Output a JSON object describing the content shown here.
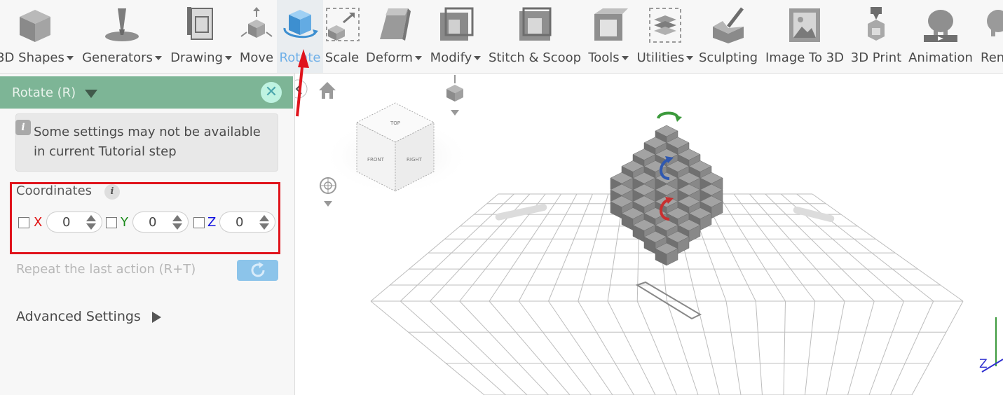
{
  "toolbar": {
    "items": [
      {
        "label": "3D Shapes",
        "dropdown": true,
        "icon": "cube-icon"
      },
      {
        "label": "Generators",
        "dropdown": true,
        "icon": "generator-spike-icon"
      },
      {
        "label": "Drawing",
        "dropdown": true,
        "icon": "drawing-pen-icon"
      },
      {
        "label": "Move",
        "dropdown": false,
        "icon": "move-arrows-icon"
      },
      {
        "label": "Rotate",
        "dropdown": false,
        "icon": "rotate-cube-icon",
        "active": true
      },
      {
        "label": "Scale",
        "dropdown": false,
        "icon": "scale-icon"
      },
      {
        "label": "Deform",
        "dropdown": true,
        "icon": "deform-icon"
      },
      {
        "label": "Modify",
        "dropdown": true,
        "icon": "modify-icon"
      },
      {
        "label": "Stitch & Scoop",
        "dropdown": false,
        "icon": "stitch-scoop-icon"
      },
      {
        "label": "Tools",
        "dropdown": true,
        "icon": "tools-icon"
      },
      {
        "label": "Utilities",
        "dropdown": true,
        "icon": "utilities-icon"
      },
      {
        "label": "Sculpting",
        "dropdown": false,
        "icon": "sculpting-icon"
      },
      {
        "label": "Image To 3D",
        "dropdown": false,
        "icon": "image-to-3d-icon"
      },
      {
        "label": "3D Print",
        "dropdown": false,
        "icon": "3d-print-icon"
      },
      {
        "label": "Animation",
        "dropdown": false,
        "icon": "animation-elephant-icon"
      },
      {
        "label": "Ren",
        "dropdown": false,
        "icon": "render-icon"
      }
    ]
  },
  "panel": {
    "title": "Rotate (R)",
    "info_text": "Some settings may not be available in current Tutorial step",
    "coordinates_label": "Coordinates",
    "axes": [
      {
        "name": "X",
        "value": "0",
        "checked": false,
        "color": "#e01010"
      },
      {
        "name": "Y",
        "value": "0",
        "checked": false,
        "color": "#1a8a1a"
      },
      {
        "name": "Z",
        "value": "0",
        "checked": false,
        "color": "#1010e0"
      }
    ],
    "repeat_label": "Repeat the last action (R+T)",
    "advanced_label": "Advanced Settings"
  },
  "viewport": {
    "view_cube": {
      "top": "TOP",
      "front": "FRONT",
      "right": "RIGHT"
    },
    "axis_label": "Z"
  },
  "colors": {
    "panel_header": "#7db596",
    "active_tool": "#6fb0e8",
    "highlight": "#e0141c",
    "repeat_button": "#8cc4ea"
  }
}
